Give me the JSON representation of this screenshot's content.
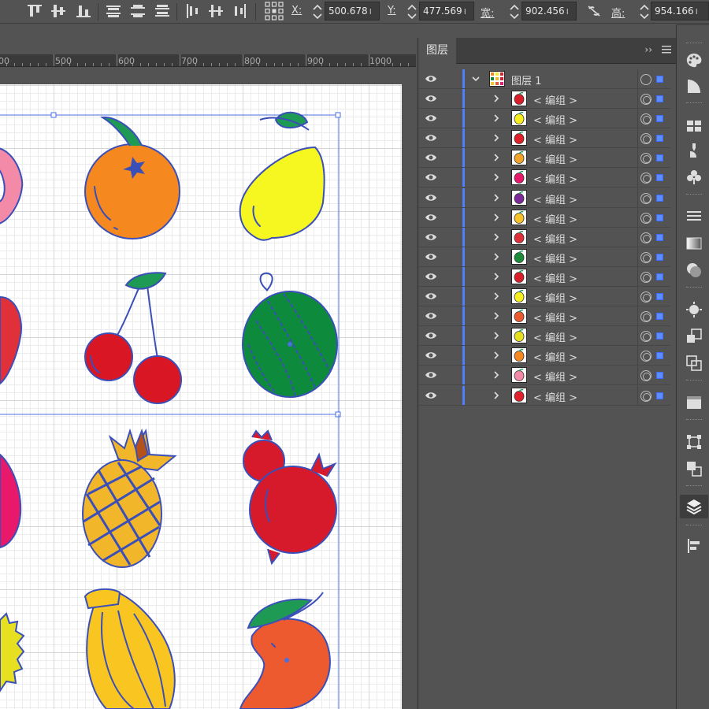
{
  "control_bar": {
    "x_label": "X:",
    "x_value": "500.678",
    "y_label": "Y:",
    "y_value": "477.569",
    "w_label": "宽:",
    "w_value": "902.456",
    "h_label": "高:",
    "h_value": "954.166",
    "unit": "ı",
    "align_icons": [
      "align-top-icon",
      "align-vcenter-icon",
      "align-bottom-icon",
      "distribute-top-icon",
      "distribute-vcenter-icon",
      "distribute-bottom-icon",
      "align-left-icon",
      "align-hcenter-icon",
      "align-right-icon"
    ],
    "reference_point_icon": "reference-point-icon",
    "link_icon": "constrain-proportions-icon"
  },
  "ruler": {
    "ticks": [
      "500",
      "600",
      "700",
      "800",
      "900",
      "1000"
    ],
    "partial_left": "00"
  },
  "layers_panel": {
    "tab_label": "图层",
    "collapse_glyph": "››",
    "layer": {
      "name": "图层 1"
    },
    "groups": [
      {
        "label": "< 编组 >",
        "fruit": "cherry",
        "color": "#d91f2a"
      },
      {
        "label": "< 编组 >",
        "fruit": "lemon",
        "color": "#f6ee21"
      },
      {
        "label": "< 编组 >",
        "fruit": "apple",
        "color": "#e0202a"
      },
      {
        "label": "< 编组 >",
        "fruit": "pineapple",
        "color": "#f0a52a"
      },
      {
        "label": "< 编组 >",
        "fruit": "dragonfruit",
        "color": "#e8186a"
      },
      {
        "label": "< 编组 >",
        "fruit": "grape",
        "color": "#7c2a9a"
      },
      {
        "label": "< 编组 >",
        "fruit": "banana",
        "color": "#f6c22a"
      },
      {
        "label": "< 编组 >",
        "fruit": "strawberry",
        "color": "#e0303a"
      },
      {
        "label": "< 编组 >",
        "fruit": "lime",
        "color": "#1c8c3a"
      },
      {
        "label": "< 编组 >",
        "fruit": "cherries",
        "color": "#d91f2a"
      },
      {
        "label": "< 编组 >",
        "fruit": "lemon",
        "color": "#f6ee21"
      },
      {
        "label": "< 编组 >",
        "fruit": "mango",
        "color": "#ee5a30"
      },
      {
        "label": "< 编组 >",
        "fruit": "pear",
        "color": "#e6e020"
      },
      {
        "label": "< 编组 >",
        "fruit": "orange",
        "color": "#f5891f"
      },
      {
        "label": "< 编组 >",
        "fruit": "peach",
        "color": "#f28aa8"
      },
      {
        "label": "< 编组 >",
        "fruit": "apple",
        "color": "#e0202a"
      }
    ]
  },
  "artwork": {
    "fruits": [
      "orange",
      "lemon",
      "cherries",
      "watermelon",
      "pineapple",
      "pomegranate",
      "banana",
      "mango"
    ],
    "colors": {
      "stroke": "#3b4fb8",
      "orange": "#f5891f",
      "lemon": "#f6f620",
      "leaf": "#1f9a55",
      "cherry": "#d91624",
      "watermelon": "#0e8a3c",
      "pineapple": "#f2b62a",
      "pomegranate": "#d61a2c",
      "banana": "#f8c521",
      "mango": "#ee5a30",
      "selection": "#4a6fe0"
    }
  },
  "tool_strip": {
    "icons": [
      "color-icon",
      "color-guide-icon",
      "swatches-icon",
      "brushes-icon",
      "symbols-icon",
      "stroke-icon",
      "gradient-icon",
      "transparency-icon",
      "appearance-icon",
      "graphic-styles-icon",
      "transform-icon",
      "artboards-icon",
      "align-panel-icon",
      "pathfinder-icon",
      "layers-icon",
      "align-icon"
    ]
  }
}
